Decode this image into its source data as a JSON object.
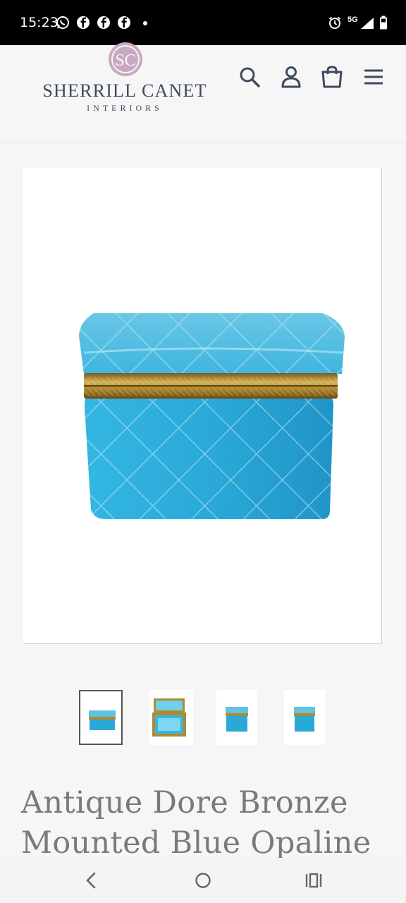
{
  "status_bar": {
    "time": "15:23",
    "network": "5G",
    "icons": [
      "whatsapp-icon",
      "facebook-icon",
      "facebook-icon",
      "facebook-icon",
      "alarm-icon",
      "signal-icon",
      "battery-icon"
    ]
  },
  "header": {
    "logo_monogram": "SC",
    "logo_name": "SHERRILL CANET",
    "logo_subtitle": "INTERIORS",
    "icons": [
      "search-icon",
      "account-icon",
      "cart-icon",
      "menu-icon"
    ],
    "colors": {
      "logo_text": "#3e4a5e",
      "logo_mark": "#c9a9c2",
      "icons": "#3e4a5e"
    }
  },
  "product": {
    "image_subject": "blue opaline box with gilt bronze mount",
    "thumbnail_count": 4,
    "active_thumbnail": 1,
    "title": "Antique Dore Bronze Mounted Blue Opaline",
    "colors": {
      "opaline": "#2cb1dc",
      "bronze": "#b08a2e"
    }
  },
  "nav_bar": {
    "buttons": [
      "back-icon",
      "home-icon",
      "recents-icon"
    ]
  }
}
